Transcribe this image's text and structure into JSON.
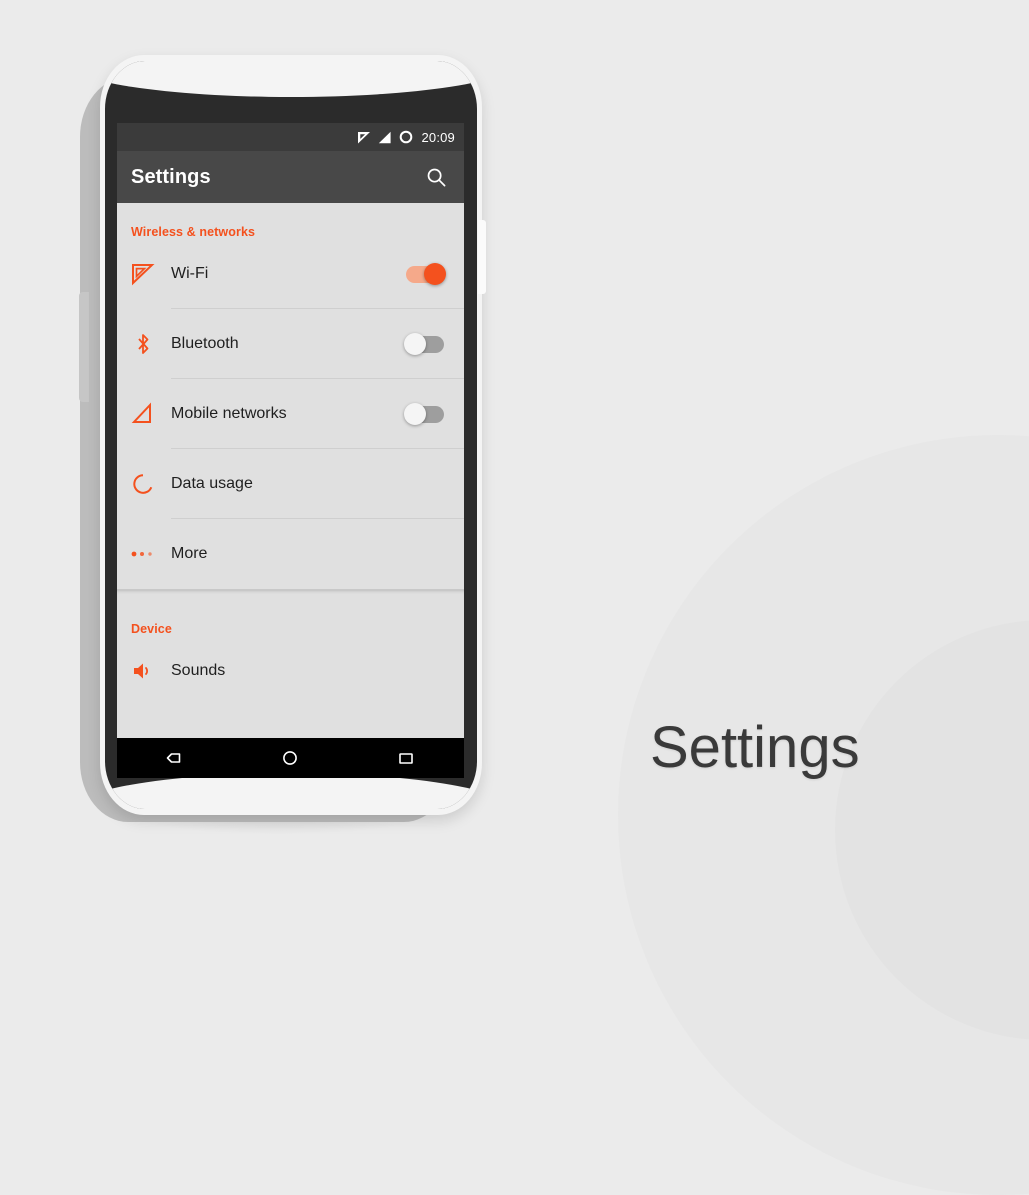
{
  "caption": "Settings",
  "colors": {
    "accent": "#f4511e",
    "page_background": "#ebebeb",
    "screen_background": "#e0e0e0",
    "app_bar": "#484848",
    "status_bar": "#3b3b3b",
    "nav_bar": "#000000",
    "switch_off_track": "#9e9e9e",
    "switch_on_track": "#f5a98a"
  },
  "phone": {
    "status_bar": {
      "time": "20:09",
      "icons": [
        "wifi-icon",
        "signal-icon",
        "circle-icon"
      ]
    },
    "app_bar": {
      "title": "Settings",
      "search_icon": "search-icon"
    },
    "sections": [
      {
        "header": "Wireless & networks",
        "rows": [
          {
            "icon": "wifi-icon",
            "label": "Wi-Fi",
            "control": "switch",
            "state": "on"
          },
          {
            "icon": "bluetooth-icon",
            "label": "Bluetooth",
            "control": "switch",
            "state": "off"
          },
          {
            "icon": "mobile-networks-icon",
            "label": "Mobile networks",
            "control": "switch",
            "state": "off"
          },
          {
            "icon": "data-usage-icon",
            "label": "Data usage",
            "control": "none",
            "state": ""
          },
          {
            "icon": "more-icon",
            "label": "More",
            "control": "none",
            "state": ""
          }
        ]
      },
      {
        "header": "Device",
        "rows": [
          {
            "icon": "sounds-icon",
            "label": "Sounds",
            "control": "none",
            "state": ""
          }
        ]
      }
    ],
    "nav_bar": {
      "back": "back-icon",
      "home": "home-icon",
      "recents": "recents-icon"
    }
  }
}
